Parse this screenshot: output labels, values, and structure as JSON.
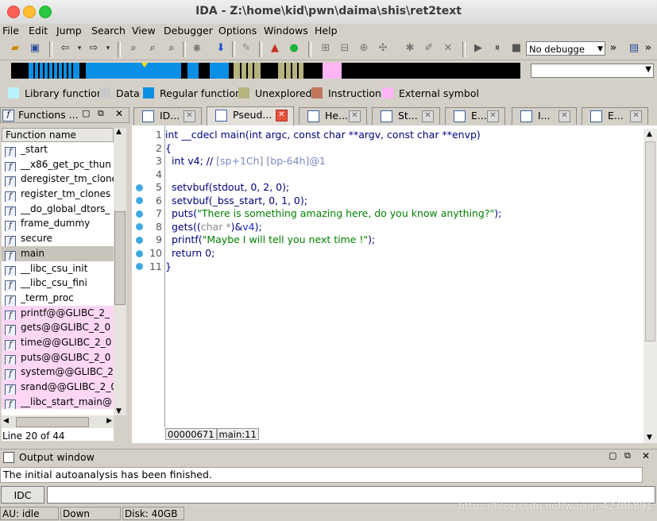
{
  "window": {
    "title": "IDA - Z:\\home\\kid\\pwn\\daima\\shis\\ret2text"
  },
  "menu": [
    "File",
    "Edit",
    "Jump",
    "Search",
    "View",
    "Debugger",
    "Options",
    "Windows",
    "Help"
  ],
  "toolbar": {
    "debugger_select": "No debugge"
  },
  "legend": [
    {
      "label": "Library function",
      "color": "#b7f2ff"
    },
    {
      "label": "Data",
      "color": "#c8c8c8"
    },
    {
      "label": "Regular function",
      "color": "#0a8fe5"
    },
    {
      "label": "Unexplored",
      "color": "#b5b47e"
    },
    {
      "label": "Instruction",
      "color": "#c0765a"
    },
    {
      "label": "External symbol",
      "color": "#ffb4f4"
    }
  ],
  "functions_panel": {
    "title": "Functions ...",
    "column_header": "Function name",
    "items": [
      {
        "name": "_start",
        "type": "regular"
      },
      {
        "name": "__x86_get_pc_thun",
        "type": "regular"
      },
      {
        "name": "deregister_tm_clone",
        "type": "regular"
      },
      {
        "name": "register_tm_clones",
        "type": "regular"
      },
      {
        "name": "__do_global_dtors_",
        "type": "regular"
      },
      {
        "name": "frame_dummy",
        "type": "regular"
      },
      {
        "name": "secure",
        "type": "regular"
      },
      {
        "name": "main",
        "type": "selected"
      },
      {
        "name": "__libc_csu_init",
        "type": "regular"
      },
      {
        "name": "__libc_csu_fini",
        "type": "regular"
      },
      {
        "name": "_term_proc",
        "type": "regular"
      },
      {
        "name": "printf@@GLIBC_2_",
        "type": "external"
      },
      {
        "name": "gets@@GLIBC_2_0",
        "type": "external"
      },
      {
        "name": "time@@GLIBC_2_0",
        "type": "external"
      },
      {
        "name": "puts@@GLIBC_2_0",
        "type": "external"
      },
      {
        "name": "system@@GLIBC_2_",
        "type": "external"
      },
      {
        "name": "srand@@GLIBC_2_0",
        "type": "external"
      },
      {
        "name": "__libc_start_main@",
        "type": "external"
      }
    ],
    "line_status": "Line 20 of 44"
  },
  "tabs": [
    {
      "label": "ID...",
      "active": false
    },
    {
      "label": "Pseud...",
      "active": true
    },
    {
      "label": "He...",
      "active": false
    },
    {
      "label": "St...",
      "active": false
    },
    {
      "label": "E...",
      "active": false
    },
    {
      "label": "I...",
      "active": false
    },
    {
      "label": "E...",
      "active": false
    }
  ],
  "code": {
    "line_numbers": [
      "1",
      "2",
      "3",
      "4",
      "5",
      "6",
      "7",
      "8",
      "9",
      "10",
      "11"
    ],
    "lines": {
      "l1": "int __cdecl main(int argc, const char **argv, const char **envp)",
      "l2": "{",
      "l3_a": "  int v4; // ",
      "l3_b": "[sp+1Ch] [bp-64h]@1",
      "l5": "  setvbuf(stdout, 0, 2, 0);",
      "l6": "  setvbuf(_bss_start, 0, 1, 0);",
      "l7_a": "  puts(",
      "l7_b": "\"There is something amazing here, do you know anything?\"",
      "l7_c": ");",
      "l8_a": "  gets((",
      "l8_b": "char *",
      "l8_c": ")&",
      "l8_d": "v4",
      "l8_e": ");",
      "l9_a": "  printf(",
      "l9_b": "\"Maybe I will tell you next time !\"",
      "l9_c": ");",
      "l10": "  return 0;",
      "l11": "}"
    },
    "status_address": "00000671",
    "status_location": "main:11"
  },
  "output": {
    "title": "Output window",
    "message": "The initial autoanalysis has been finished.",
    "idc_label": "IDC"
  },
  "statusbar": {
    "au": "AU:  idle",
    "direction": "Down",
    "disk": "Disk: 40GB"
  },
  "watermark": "https://blog.csdn.net/weixin_42306891"
}
